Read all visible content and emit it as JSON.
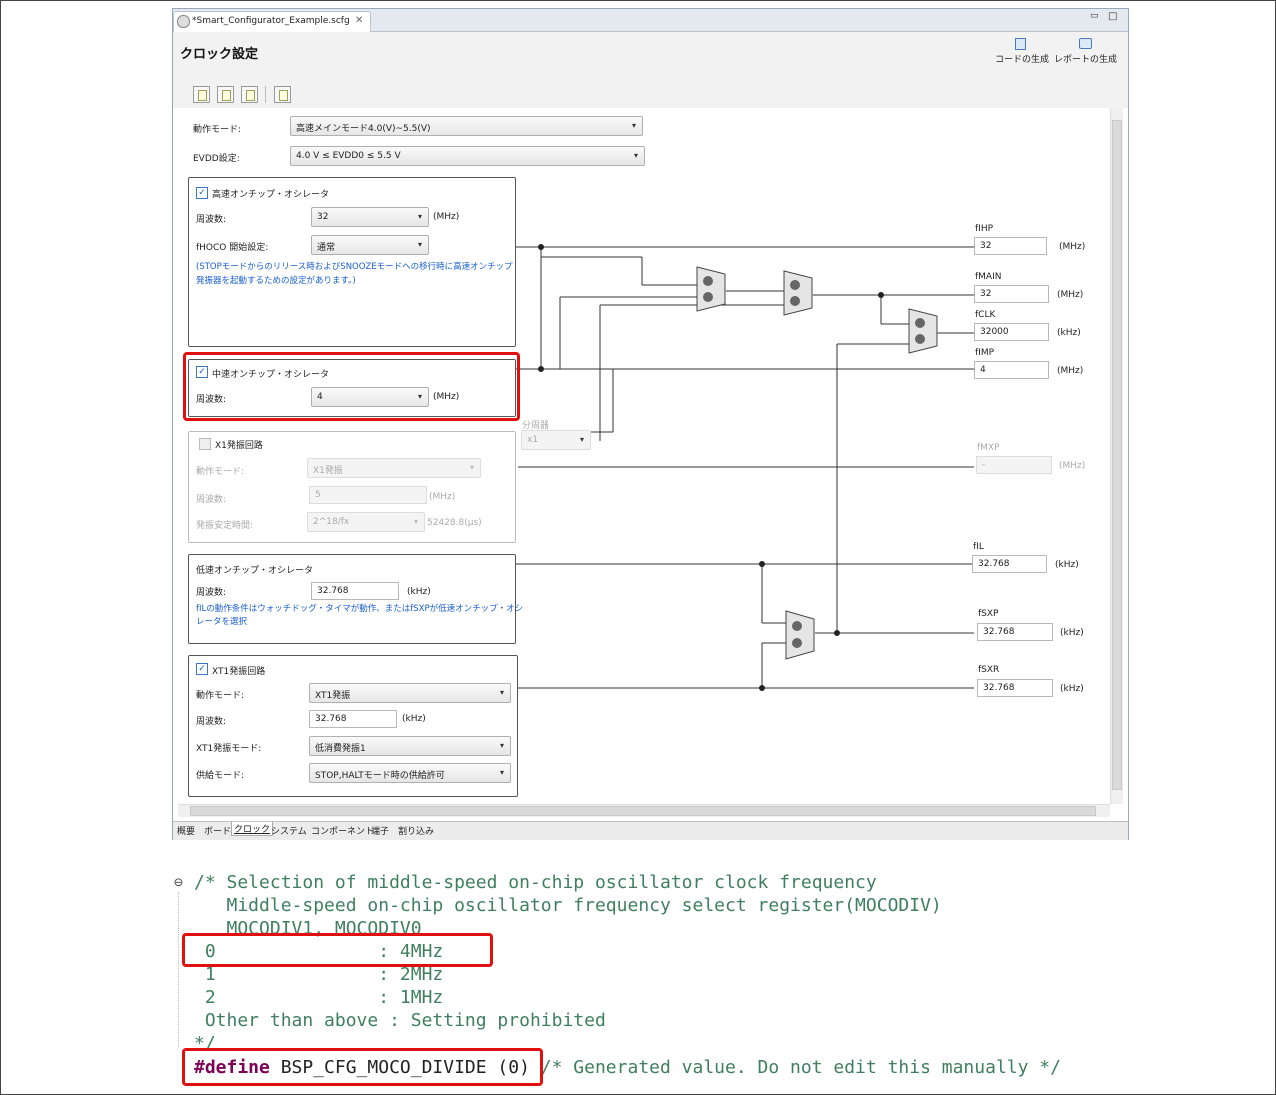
{
  "editor": {
    "tab_title": "*Smart_Configurator_Example.scfg",
    "tab_close": "✕",
    "window_controls": [
      "▭",
      "□"
    ],
    "page_title": "クロック設定",
    "actions": {
      "generate_code": "コードの生成",
      "generate_report": "レポートの生成"
    }
  },
  "settings": {
    "operation_mode": {
      "label": "動作モード:",
      "value": "高速メインモード4.0(V)~5.5(V)"
    },
    "evdd": {
      "label": "EVDD設定:",
      "value": "4.0 V ≤ EVDD0 ≤ 5.5 V"
    }
  },
  "hoco": {
    "title": "高速オンチップ・オシレータ",
    "checked": true,
    "freq_label": "周波数:",
    "freq_value": "32",
    "freq_unit": "(MHz)",
    "start_label": "fHOCO 開始設定:",
    "start_value": "通常",
    "note_line1": "(STOPモードからのリリース時およびSNOOZEモードへの移行時に高速オンチップ",
    "note_line2": "発振器を起動するための設定があります。)"
  },
  "moco": {
    "title": "中速オンチップ・オシレータ",
    "checked": true,
    "freq_label": "周波数:",
    "freq_value": "4",
    "freq_unit": "(MHz)"
  },
  "divider": {
    "label": "分周器",
    "value": "x1"
  },
  "x1": {
    "title": "X1発振回路",
    "checked": false,
    "mode_label": "動作モード:",
    "mode_value": "X1発振",
    "freq_label": "周波数:",
    "freq_value": "5",
    "freq_unit": "(MHz)",
    "stab_label": "発振安定時間:",
    "stab_value": "2^18/fx",
    "stab_result": "52428.8(μs)"
  },
  "loco": {
    "title": "低速オンチップ・オシレータ",
    "freq_label": "周波数:",
    "freq_value": "32.768",
    "freq_unit": "(kHz)",
    "note_line1": "fILの動作条件はウォッチドッグ・タイマが動作、またはfSXPが低速オンチップ・オシ",
    "note_line2": "レータを選択"
  },
  "xt1": {
    "title": "XT1発振回路",
    "checked": true,
    "mode_label": "動作モード:",
    "mode_value": "XT1発振",
    "freq_label": "周波数:",
    "freq_value": "32.768",
    "freq_unit": "(kHz)",
    "osc_mode_label": "XT1発振モード:",
    "osc_mode_value": "低消費発振1",
    "supply_label": "供給モード:",
    "supply_value": "STOP,HALTモード時の供給許可"
  },
  "outputs": {
    "fihp": {
      "label": "fIHP",
      "value": "32",
      "unit": "(MHz)"
    },
    "fmain": {
      "label": "fMAIN",
      "value": "32",
      "unit": "(MHz)"
    },
    "fclk": {
      "label": "fCLK",
      "value": "32000",
      "unit": "(kHz)"
    },
    "fimp": {
      "label": "fIMP",
      "value": "4",
      "unit": "(MHz)"
    },
    "fmxp": {
      "label": "fMXP",
      "value": "-",
      "unit": "(MHz)"
    },
    "fil": {
      "label": "fIL",
      "value": "32.768",
      "unit": "(kHz)"
    },
    "fsxp": {
      "label": "fSXP",
      "value": "32.768",
      "unit": "(kHz)"
    },
    "fsxr": {
      "label": "fSXR",
      "value": "32.768",
      "unit": "(kHz)"
    }
  },
  "bottom_tabs": [
    "概要",
    "ボード",
    "クロック",
    "システム",
    "コンポーネント",
    "端子",
    "割り込み"
  ],
  "active_bottom_tab": "クロック",
  "code": {
    "fold_icon": "⊖",
    "line1": "/* Selection of middle-speed on-chip oscillator clock frequency",
    "line2": "   Middle-speed on-chip oscillator frequency select register(MOCODIV)",
    "line3": "   MOCODIV1, MOCODIV0",
    "line4": " 0               : 4MHz",
    "line5": " 1               : 2MHz",
    "line6": " 2               : 1MHz",
    "line7": " Other than above : Setting prohibited",
    "line8": "*/",
    "define_kw": "#define",
    "define_name": " BSP_CFG_MOCO_DIVIDE (0)",
    "define_comment": " /* Generated value. Do not edit this manually */"
  },
  "colors": {
    "highlight": "#e01010",
    "comment": "#3f7f5f",
    "keyword": "#7f0055",
    "note": "#1a5fd0"
  }
}
